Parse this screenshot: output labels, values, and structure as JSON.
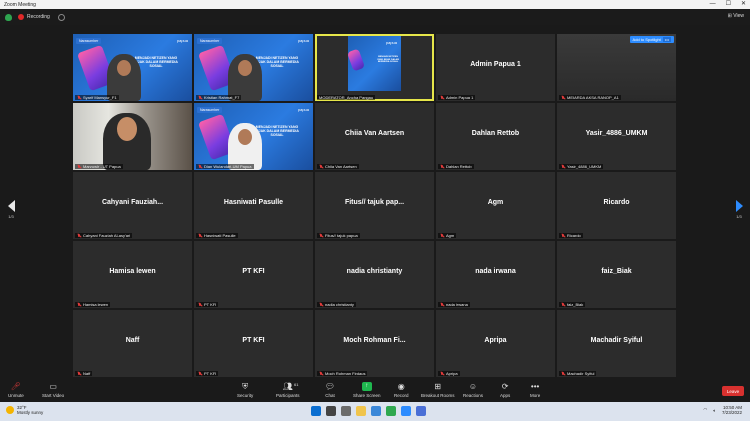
{
  "window": {
    "title": "Zoom Meeting",
    "minimize": "—",
    "maximize": "☐",
    "close": "✕"
  },
  "topbar": {
    "recording_label": "Recording",
    "view_label": "View"
  },
  "spotlight": {
    "button_label": "Add to Spotlight",
    "more": "•••"
  },
  "pager": {
    "left": "1/3",
    "right": "1/3"
  },
  "tiles": [
    {
      "type": "slide",
      "label": "Syarif Mansyur_F1",
      "speaker": true
    },
    {
      "type": "slide",
      "label": "Kristian Rahmat_F7",
      "speaker": true
    },
    {
      "type": "slide-small",
      "label": "MODERATOR_Ancha Pangau",
      "highlight": true,
      "muted": false
    },
    {
      "type": "name",
      "name": "Admin Papua 1",
      "label": "Admin Papua 1"
    },
    {
      "type": "video",
      "label": "MEIARDA AKSA RANOP_A1"
    },
    {
      "type": "video",
      "label": "Marzuwir - UT Papua"
    },
    {
      "type": "slide",
      "label": "Dian Wulandari-UM Papua",
      "speaker": true
    },
    {
      "type": "name",
      "name": "Chiia Van Aartsen",
      "label": "Chiia Van Aartsen"
    },
    {
      "type": "name",
      "name": "Dahlan Rettob",
      "label": "Dahlan Rettob"
    },
    {
      "type": "name",
      "name": "Yasir_4886_UMKM",
      "label": "Yasir_4886_UMKM"
    },
    {
      "type": "name",
      "name": "Cahyani Fauziah...",
      "label": "Cahyani Fauziah Al-asy'ari"
    },
    {
      "type": "name",
      "name": "Hasniwati Pasulle",
      "label": "Hasniwati Pasulle"
    },
    {
      "type": "name",
      "name": "Fitus// tajuk pap...",
      "label": "Fitus// tajuk papua"
    },
    {
      "type": "name",
      "name": "Agm",
      "label": "Agm"
    },
    {
      "type": "name",
      "name": "Ricardo",
      "label": "Ricardo"
    },
    {
      "type": "name",
      "name": "Hamisa lewen",
      "label": "Hamisa lewen"
    },
    {
      "type": "name",
      "name": "PT KFI",
      "label": "PT KFI"
    },
    {
      "type": "name",
      "name": "nadia christianty",
      "label": "nadia christianty"
    },
    {
      "type": "name",
      "name": "nada irwana",
      "label": "nada irwana"
    },
    {
      "type": "name",
      "name": "faiz_Biak",
      "label": "faiz_Biak"
    },
    {
      "type": "name",
      "name": "Naff",
      "label": "Naff"
    },
    {
      "type": "name",
      "name": "PT KFI",
      "label": "PT KFI"
    },
    {
      "type": "name",
      "name": "Moch  Rohman  Fi...",
      "label": "Moch Rohman Firdaus"
    },
    {
      "type": "name",
      "name": "Apripa",
      "label": "Apripa"
    },
    {
      "type": "name",
      "name": "Machadir Syiful",
      "label": "Machadir Syiful"
    }
  ],
  "slide": {
    "tag": "Narasumber",
    "logos": "papua",
    "headline": "MENJADI NETIZEN YANG BIJAK DALAM BERMEDIA SOSIAL"
  },
  "toolbar": {
    "unmute": "Unmute",
    "video": "Start Video",
    "security": "Security",
    "participants": "Participants",
    "participants_count": "61",
    "chat": "Chat",
    "share": "Share Screen",
    "record": "Record",
    "breakout": "Breakout Rooms",
    "reactions": "Reactions",
    "apps": "Apps",
    "more": "More",
    "leave": "Leave"
  },
  "taskbar": {
    "temp": "32°F",
    "weather": "Mostly sunny",
    "time": "10:50 AM",
    "date": "7/23/2022"
  },
  "colors": {
    "accent": "#2d8cff",
    "share_green": "#1fb84f",
    "leave_red": "#d8312f",
    "highlight": "#e6e64a"
  }
}
